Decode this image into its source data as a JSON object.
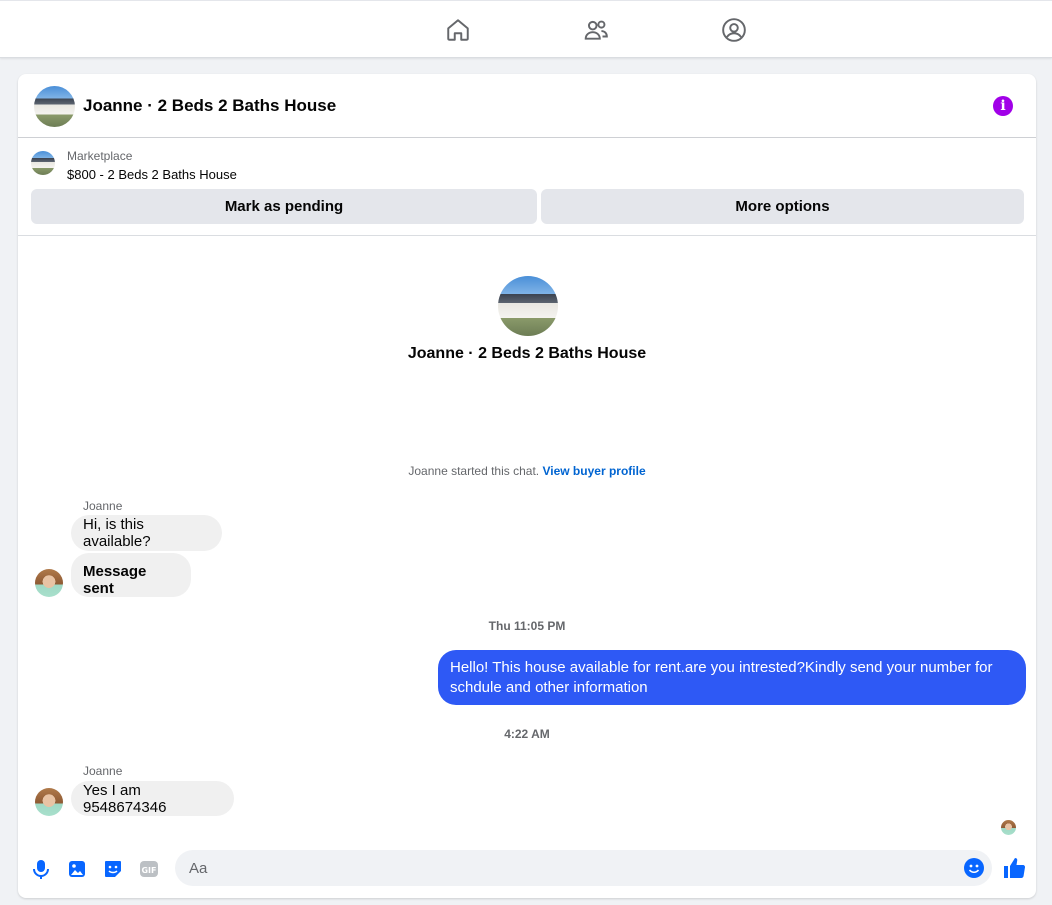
{
  "nav": {
    "icons": [
      "home-icon",
      "friends-icon",
      "profile-icon"
    ]
  },
  "header": {
    "title": "Joanne · 2 Beds 2 Baths House"
  },
  "marketplace": {
    "source": "Marketplace",
    "item": "$800 - 2 Beds 2 Baths House",
    "mark_pending": "Mark as pending",
    "more_options": "More options"
  },
  "intro": {
    "title": "Joanne · 2 Beds 2 Baths House",
    "started_text": "Joanne started this chat.",
    "profile_link": "View buyer profile"
  },
  "messages": {
    "sender1": "Joanne",
    "msg1": "Hi, is this available?",
    "msg2": "Message sent",
    "ts1": "Thu 11:05 PM",
    "out1": "Hello! This house available for rent.are you intrested?Kindly send your number for schdule and other information",
    "ts2": "4:22 AM",
    "sender2": "Joanne",
    "msg3": "Yes I am 9548674346"
  },
  "composer": {
    "placeholder": "Aa"
  },
  "colors": {
    "accent": "#0866ff",
    "bubble_out": "#2e59f5",
    "info": "#a100e8"
  }
}
